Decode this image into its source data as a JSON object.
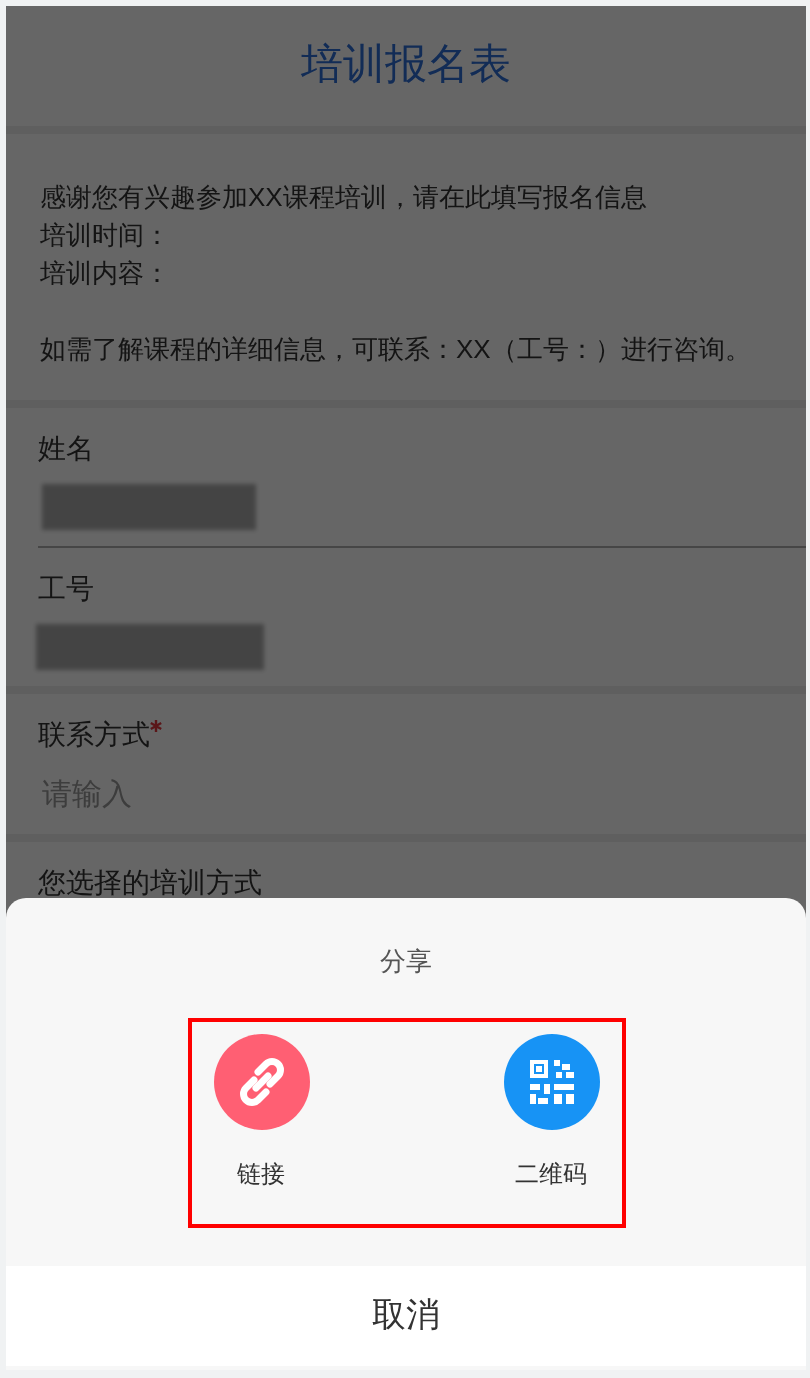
{
  "form": {
    "title": "培训报名表",
    "intro": [
      "感谢您有兴趣参加XX课程培训，请在此填写报名信息",
      "培训时间：",
      "培训内容："
    ],
    "note": "如需了解课程的详细信息，可联系：XX（工号：）进行咨询。",
    "fields": [
      {
        "kind": "redacted",
        "label": "姓名",
        "required": false
      },
      {
        "kind": "redacted",
        "label": "工号",
        "required": false
      },
      {
        "kind": "input",
        "label": "联系方式",
        "required": true,
        "placeholder": "请输入"
      },
      {
        "kind": "choice",
        "label": "您选择的培训方式",
        "required": false
      }
    ]
  },
  "share_sheet": {
    "title": "分享",
    "options": [
      {
        "kind": "link",
        "label": "链接"
      },
      {
        "kind": "qrcode",
        "label": "二维码"
      }
    ],
    "cancel": "取消"
  }
}
